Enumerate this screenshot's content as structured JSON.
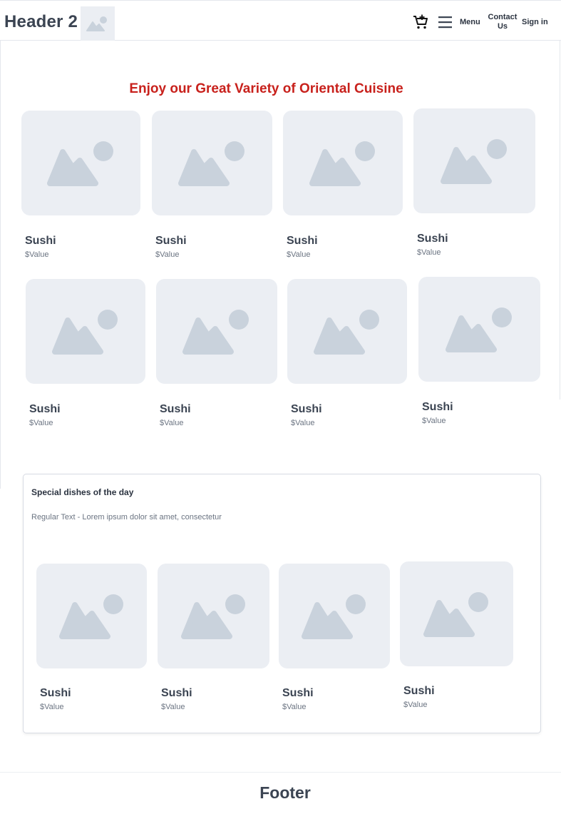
{
  "header": {
    "brand": "Header 2",
    "logo_icon": "image-placeholder-icon",
    "cart_icon": "add-to-cart-icon",
    "menu_icon": "hamburger-menu-icon",
    "nav": {
      "menu": "Menu",
      "contact_line1": "Contact",
      "contact_line2": "Us",
      "signin": "Sign in"
    }
  },
  "main": {
    "heading": "Enjoy our Great Variety of Oriental Cuisine",
    "products": [
      {
        "name": "Sushi",
        "price": "$Value"
      },
      {
        "name": "Sushi",
        "price": "$Value"
      },
      {
        "name": "Sushi",
        "price": "$Value"
      },
      {
        "name": "Sushi",
        "price": "$Value"
      },
      {
        "name": "Sushi",
        "price": "$Value"
      },
      {
        "name": "Sushi",
        "price": "$Value"
      },
      {
        "name": "Sushi",
        "price": "$Value"
      },
      {
        "name": "Sushi",
        "price": "$Value"
      }
    ]
  },
  "special": {
    "title": "Special dishes of the day",
    "text": "Regular Text - Lorem ipsum dolor sit amet, consectetur",
    "products": [
      {
        "name": "Sushi",
        "price": "$Value"
      },
      {
        "name": "Sushi",
        "price": "$Value"
      },
      {
        "name": "Sushi",
        "price": "$Value"
      },
      {
        "name": "Sushi",
        "price": "$Value"
      }
    ]
  },
  "footer": {
    "text": "Footer"
  },
  "colors": {
    "heading_red": "#c8211c",
    "placeholder_bg": "#ebeef3",
    "placeholder_shape": "#c9d2dc",
    "text_dark": "#3b4452",
    "text_muted": "#6b7482"
  }
}
